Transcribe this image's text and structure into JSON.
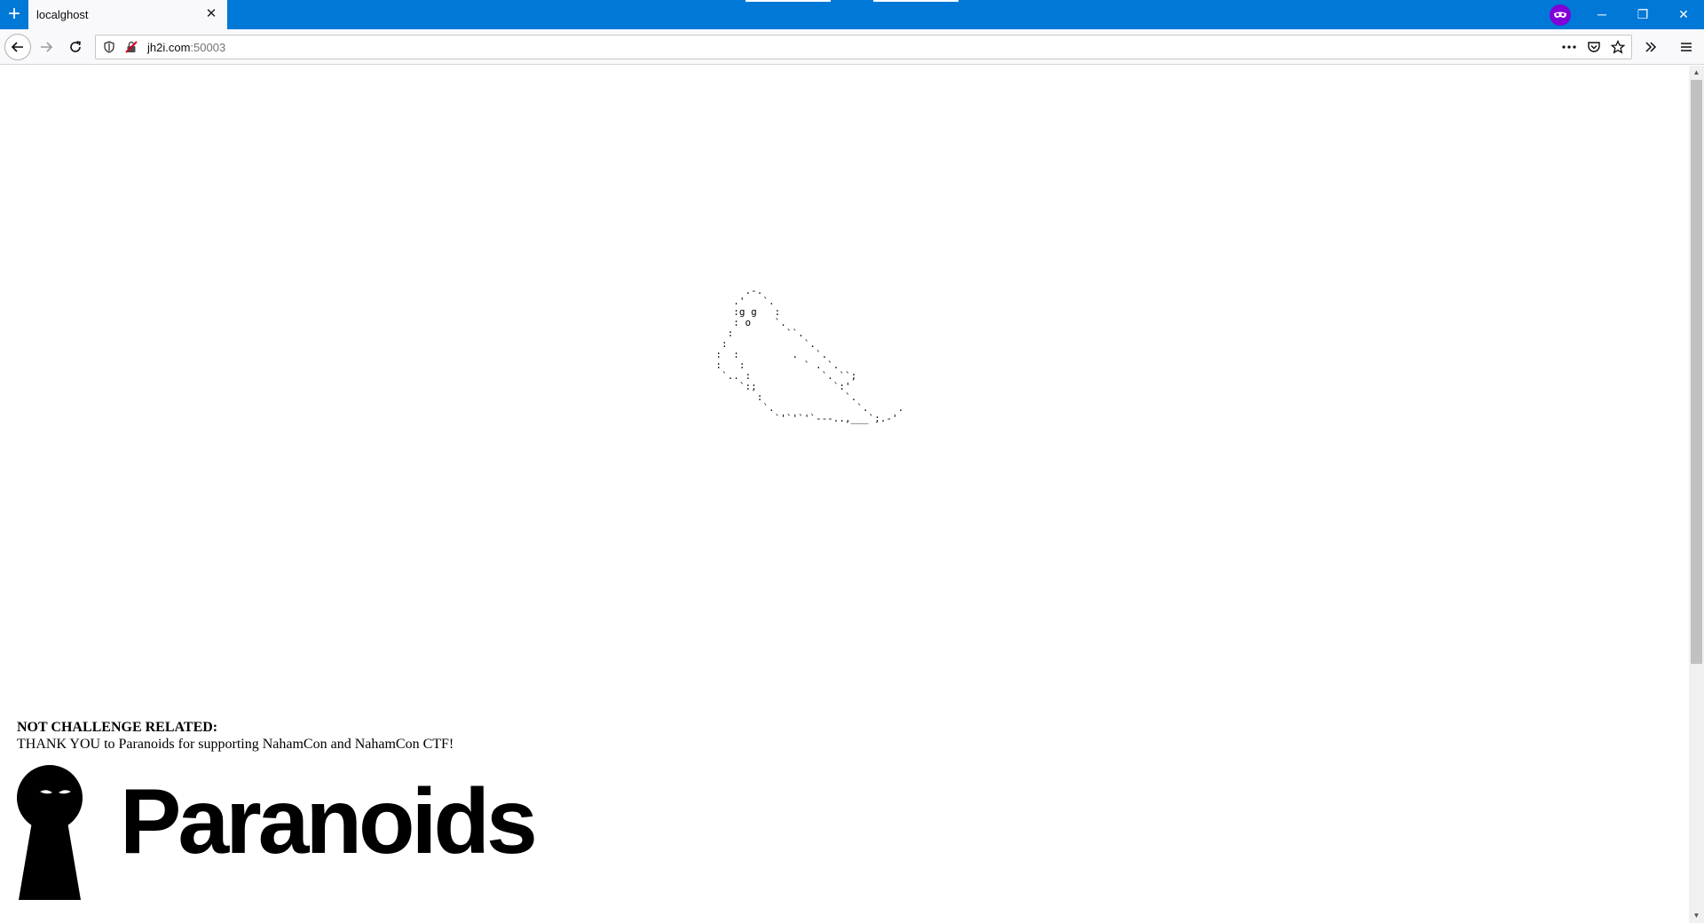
{
  "browser": {
    "tab": {
      "title": "localghost",
      "close_glyph": "✕"
    },
    "new_tab_glyph": "+",
    "window_controls": {
      "minimize": "─",
      "restore": "❐",
      "close": "✕"
    },
    "nav": {
      "back_icon": "back-arrow-icon",
      "forward_icon": "forward-arrow-icon",
      "reload_icon": "reload-icon"
    },
    "url": {
      "host": "jh2i.com",
      "port": ":50003"
    },
    "toolbar_icons": [
      "page-actions-icon",
      "pocket-icon",
      "bookmark-star-icon",
      "overflow-icon",
      "menu-icon"
    ],
    "accent_color": "#0078d7",
    "private_color": "#8000d7"
  },
  "page": {
    "ascii_art": "            .-.\n          .'   `.\n          :g g   :\n          : o    `.\n         :         ``.\n        :             `.\n       :  :         .   `.\n       :   :          ` . `.\n        `.. :            `. ``;\n           `:;             `:'\n              :              `.\n               `.              `.     .\n                 `'`'`'`---..,___`;.-'",
    "footer": {
      "heading": "NOT CHALLENGE RELATED:",
      "message": "THANK YOU to Paranoids for supporting NahamCon and NahamCon CTF!"
    },
    "logo_text": "Paranoids"
  }
}
